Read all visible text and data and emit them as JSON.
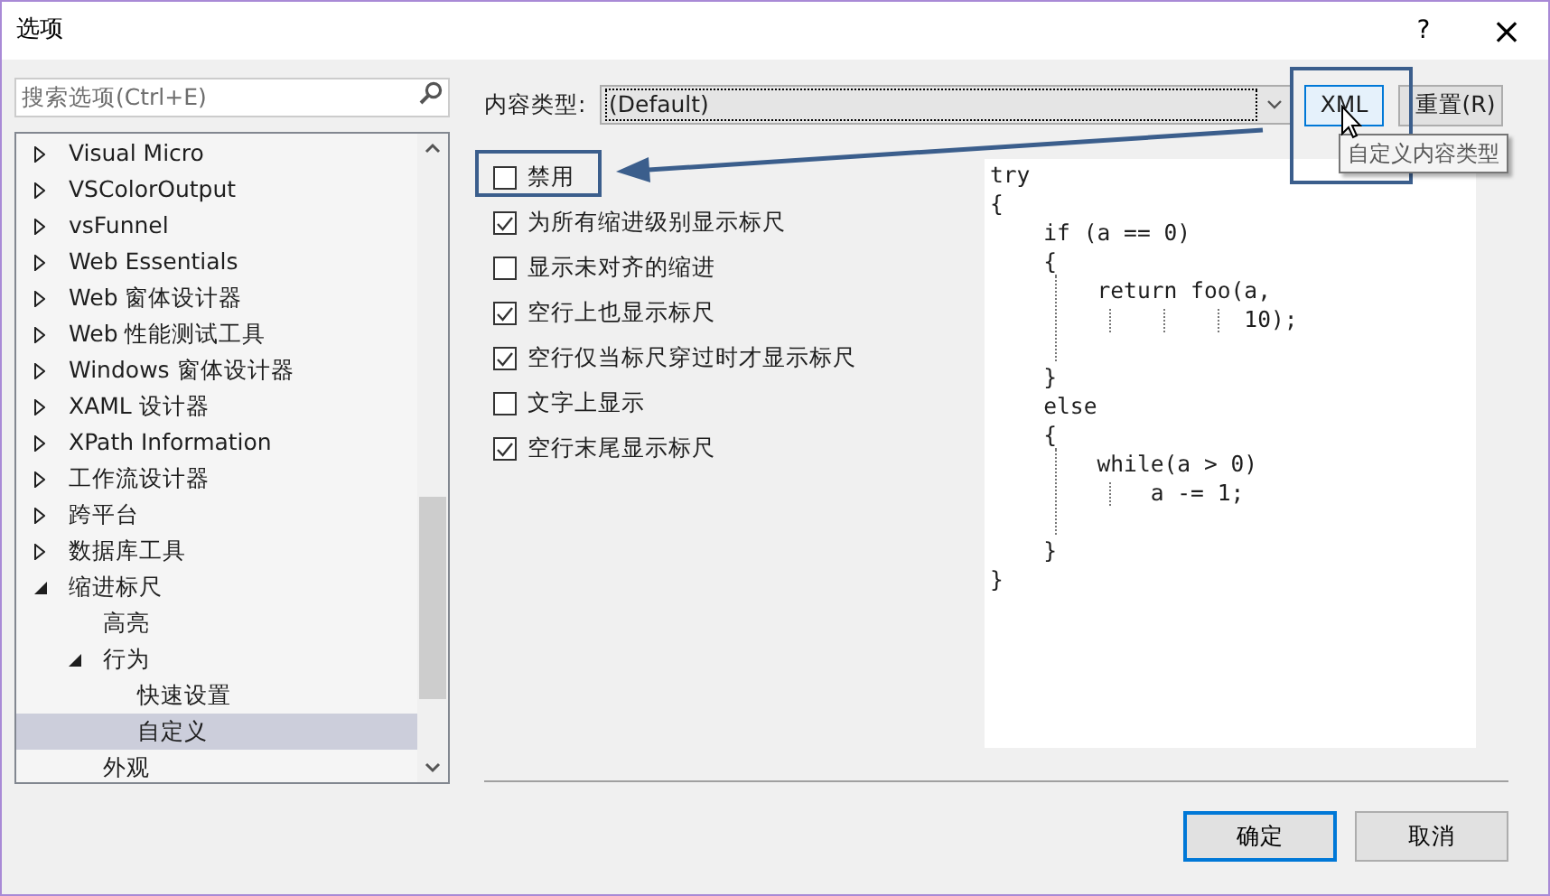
{
  "window": {
    "title": "选项",
    "help": "?",
    "close": "×"
  },
  "search": {
    "placeholder": "搜索选项(Ctrl+E)"
  },
  "tree": [
    {
      "label": "Visual Micro",
      "expanded": false,
      "selected": false
    },
    {
      "label": "VSColorOutput",
      "expanded": false,
      "selected": false
    },
    {
      "label": "vsFunnel",
      "expanded": false,
      "selected": false
    },
    {
      "label": "Web Essentials",
      "expanded": false,
      "selected": false
    },
    {
      "label": "Web 窗体设计器",
      "expanded": false,
      "selected": false
    },
    {
      "label": "Web 性能测试工具",
      "expanded": false,
      "selected": false
    },
    {
      "label": "Windows 窗体设计器",
      "expanded": false,
      "selected": false
    },
    {
      "label": "XAML 设计器",
      "expanded": false,
      "selected": false
    },
    {
      "label": "XPath Information",
      "expanded": false,
      "selected": false
    },
    {
      "label": "工作流设计器",
      "expanded": false,
      "selected": false
    },
    {
      "label": "跨平台",
      "expanded": false,
      "selected": false
    },
    {
      "label": "数据库工具",
      "expanded": false,
      "selected": false
    },
    {
      "label": "缩进标尺",
      "expanded": true,
      "selected": false,
      "children": [
        {
          "label": "高亮",
          "selected": false
        },
        {
          "label": "行为",
          "expanded": true,
          "selected": false,
          "children": [
            {
              "label": "快速设置",
              "selected": false
            },
            {
              "label": "自定义",
              "selected": true
            }
          ]
        },
        {
          "label": "外观",
          "selected": false
        }
      ]
    }
  ],
  "content_type": {
    "label": "内容类型:",
    "value": "(Default)"
  },
  "buttons_top": [
    {
      "label": "XML",
      "hovered": true
    },
    {
      "label": "重置(R)",
      "hovered": false
    }
  ],
  "tooltip": "自定义内容类型",
  "options": [
    {
      "label": "禁用",
      "checked": false
    },
    {
      "label": "为所有缩进级别显示标尺",
      "checked": true
    },
    {
      "label": "显示未对齐的缩进",
      "checked": false
    },
    {
      "label": "空行上也显示标尺",
      "checked": true
    },
    {
      "label": "空行仅当标尺穿过时才显示标尺",
      "checked": true
    },
    {
      "label": "文字上显示",
      "checked": false
    },
    {
      "label": "空行末尾显示标尺",
      "checked": true
    }
  ],
  "code_preview": [
    {
      "kind": "code",
      "text": "try"
    },
    {
      "kind": "code",
      "text": "{"
    },
    {
      "kind": "code",
      "text": "    if (a == 0)"
    },
    {
      "kind": "code",
      "text": "    {"
    },
    {
      "kind": "code",
      "text": "        return foo(a,"
    },
    {
      "kind": "code",
      "text": "                   10);"
    },
    {
      "kind": "blank"
    },
    {
      "kind": "code",
      "text": "    }"
    },
    {
      "kind": "code",
      "text": "    else"
    },
    {
      "kind": "code",
      "text": "    {"
    },
    {
      "kind": "code",
      "text": "        while(a > 0)"
    },
    {
      "kind": "code",
      "text": "            a -= 1;"
    },
    {
      "kind": "blank"
    },
    {
      "kind": "code",
      "text": "    }"
    },
    {
      "kind": "code",
      "text": "}"
    }
  ],
  "footer_buttons": [
    {
      "label": "确定",
      "default": true
    },
    {
      "label": "取消",
      "default": false
    }
  ]
}
